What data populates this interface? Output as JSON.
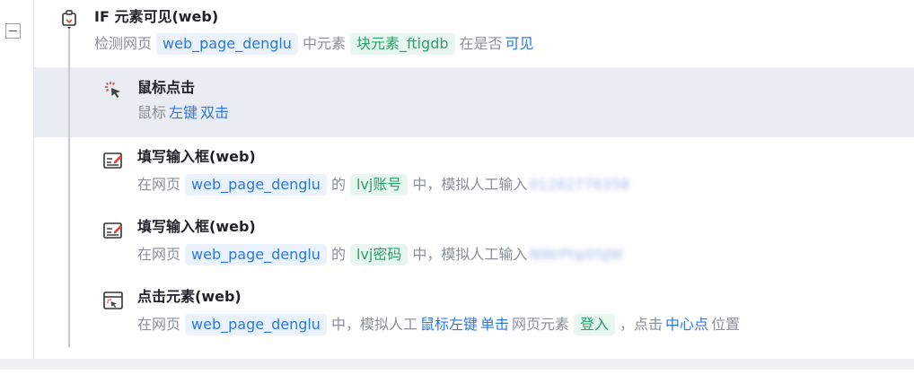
{
  "if_block": {
    "title": "IF 元素可见(web)",
    "desc": {
      "t1": "检测网页",
      "page": "web_page_denglu",
      "t2": "中元素",
      "element": "块元素_ftigdb",
      "t3": "在是否",
      "state": "可见"
    }
  },
  "steps": [
    {
      "title": "鼠标点击",
      "icon": "mouse-click-icon",
      "desc": {
        "t1": "鼠标",
        "button": "左键",
        "action": "双击"
      }
    },
    {
      "title": "填写输入框(web)",
      "icon": "input-form-icon",
      "desc": {
        "t1": "在网页",
        "page": "web_page_denglu",
        "t2": "的",
        "element": "lvj账号",
        "t3": "中，模拟人工输入",
        "value": "01262776358"
      }
    },
    {
      "title": "填写输入框(web)",
      "icon": "input-form-icon",
      "desc": {
        "t1": "在网页",
        "page": "web_page_denglu",
        "t2": "的",
        "element": "lvj密码",
        "t3": "中，模拟人工输入",
        "value": "NWrPhp0SJW"
      }
    },
    {
      "title": "点击元素(web)",
      "icon": "click-element-icon",
      "desc": {
        "t1": "在网页",
        "page": "web_page_denglu",
        "t2": "中，模拟人工",
        "button": "鼠标左键",
        "action": "单击",
        "t3": "网页元素",
        "element": "登入",
        "t4": "，点击",
        "position": "中心点",
        "t5": "位置"
      }
    }
  ],
  "colors": {
    "keyword_blue": "#2b78e4",
    "element_green": "#2ba16a",
    "highlight_row": "#e9edf3"
  }
}
